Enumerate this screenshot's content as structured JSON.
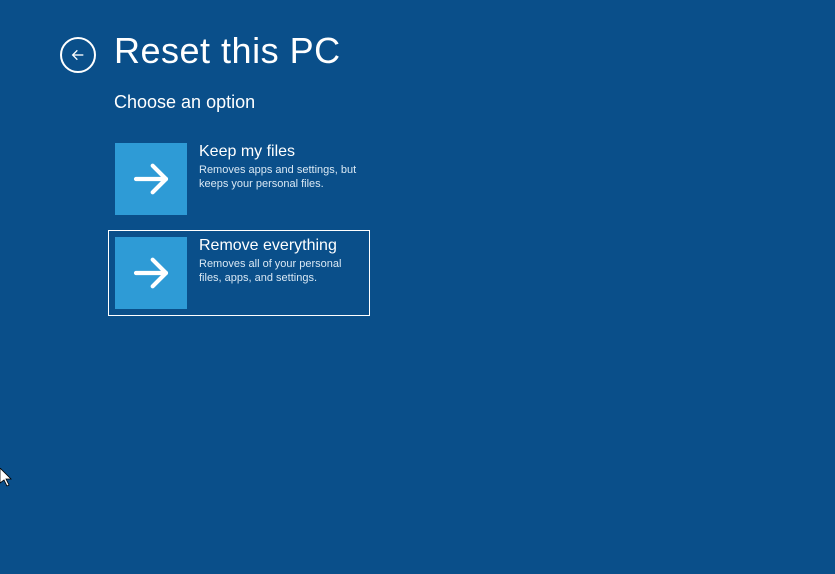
{
  "header": {
    "title": "Reset this PC",
    "subtitle": "Choose an option"
  },
  "options": [
    {
      "title": "Keep my files",
      "description": "Removes apps and settings, but keeps your personal files.",
      "selected": false
    },
    {
      "title": "Remove everything",
      "description": "Removes all of your personal files, apps, and settings.",
      "selected": true
    }
  ],
  "colors": {
    "background": "#0a4f8a",
    "tile": "#2e9bd6"
  }
}
